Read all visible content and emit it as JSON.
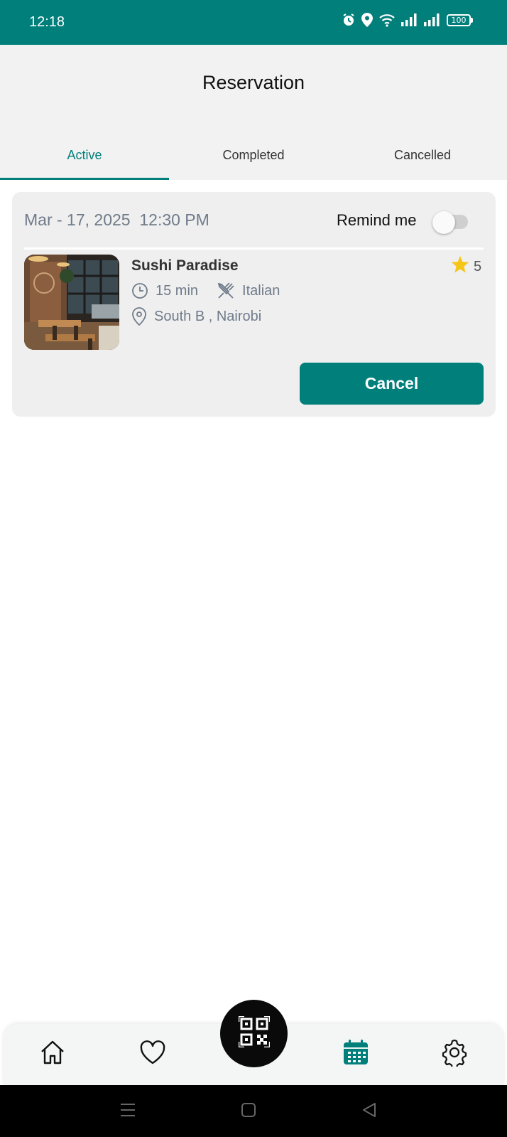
{
  "status_bar": {
    "time": "12:18",
    "battery": "100",
    "icons": [
      "alarm-icon",
      "location-icon",
      "wifi-icon",
      "signal-icon",
      "signal-icon",
      "battery-icon"
    ]
  },
  "header": {
    "title": "Reservation"
  },
  "tabs": [
    {
      "label": "Active",
      "active": true
    },
    {
      "label": "Completed",
      "active": false
    },
    {
      "label": "Cancelled",
      "active": false
    }
  ],
  "reservation": {
    "date": "Mar - 17, 2025  12:30 PM",
    "remind_label": "Remind me",
    "remind_on": false,
    "restaurant_name": "Sushi Paradise",
    "rating": "5",
    "duration": "15 min",
    "cuisine": "Italian",
    "location": "South B , Nairobi",
    "cancel_label": "Cancel"
  },
  "bottom_nav": {
    "items": [
      "home-icon",
      "heart-icon",
      "qr-code-icon",
      "calendar-icon",
      "settings-icon"
    ],
    "active": "calendar-icon"
  },
  "colors": {
    "brand": "#007f7b",
    "star": "#f5c518",
    "meta_text": "#6f7b8a"
  }
}
